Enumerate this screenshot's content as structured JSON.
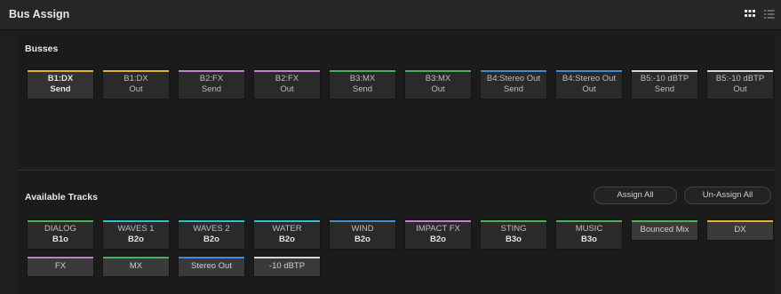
{
  "title": "Bus Assign",
  "icons": {
    "grid": "grid-view-icon",
    "list": "list-view-icon"
  },
  "busses": {
    "label": "Busses",
    "items": [
      {
        "name": "B1:DX",
        "sub": "Send",
        "color": "#e2b32a",
        "selected": true
      },
      {
        "name": "B1:DX",
        "sub": "Out",
        "color": "#e2b32a",
        "selected": false
      },
      {
        "name": "B2:FX",
        "sub": "Send",
        "color": "#c77bd1",
        "selected": false
      },
      {
        "name": "B2:FX",
        "sub": "Out",
        "color": "#c77bd1",
        "selected": false
      },
      {
        "name": "B3:MX",
        "sub": "Send",
        "color": "#46b45a",
        "selected": false
      },
      {
        "name": "B3:MX",
        "sub": "Out",
        "color": "#46b45a",
        "selected": false
      },
      {
        "name": "B4:Stereo Out",
        "sub": "Send",
        "color": "#3f8ed6",
        "selected": false
      },
      {
        "name": "B4:Stereo Out",
        "sub": "Out",
        "color": "#3f8ed6",
        "selected": false
      },
      {
        "name": "B5:-10 dBTP",
        "sub": "Send",
        "color": "#d9d9d9",
        "selected": false
      },
      {
        "name": "B5:-10 dBTP",
        "sub": "Out",
        "color": "#d9d9d9",
        "selected": false
      }
    ]
  },
  "tracks": {
    "label": "Available Tracks",
    "assign_all": "Assign All",
    "unassign_all": "Un-Assign All",
    "items": [
      {
        "name": "DIALOG",
        "bus": "B1o",
        "color": "#46b45a"
      },
      {
        "name": "WAVES 1",
        "bus": "B2o",
        "color": "#2ec3c3"
      },
      {
        "name": "WAVES 2",
        "bus": "B2o",
        "color": "#2ec3c3"
      },
      {
        "name": "WATER",
        "bus": "B2o",
        "color": "#2ec3c3"
      },
      {
        "name": "WIND",
        "bus": "B2o",
        "color": "#3f8ed6"
      },
      {
        "name": "IMPACT FX",
        "bus": "B2o",
        "color": "#c77bd1"
      },
      {
        "name": "STING",
        "bus": "B3o",
        "color": "#46b45a"
      },
      {
        "name": "MUSIC",
        "bus": "B3o",
        "color": "#46b45a"
      }
    ],
    "bus_tracks": [
      {
        "name": "Bounced Mix",
        "color": "#46b45a"
      },
      {
        "name": "DX",
        "color": "#e2b32a"
      },
      {
        "name": "FX",
        "color": "#c77bd1"
      },
      {
        "name": "MX",
        "color": "#46b45a"
      },
      {
        "name": "Stereo Out",
        "color": "#3f8ed6"
      },
      {
        "name": "-10 dBTP",
        "color": "#d9d9d9"
      }
    ]
  }
}
